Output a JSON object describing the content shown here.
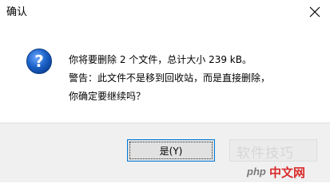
{
  "window": {
    "title": "确认",
    "close_label": "×"
  },
  "message": {
    "line1": "你将要删除 2 个文件，总计大小 239 kB。",
    "line2": "警告：此文件不是移到回收站，而是直接删除，",
    "line3": "你确定要继续吗？"
  },
  "buttons": {
    "yes_label": "是(Y)"
  },
  "watermark": {
    "line1": "软件技巧",
    "logo_php": "php",
    "logo_cn": "中文网"
  },
  "colors": {
    "accent": "#0078d7",
    "footer_bg": "#f0f0f0",
    "icon_blue": "#1c63c8"
  },
  "icons": {
    "dialog": "question-icon",
    "close": "close-icon"
  }
}
